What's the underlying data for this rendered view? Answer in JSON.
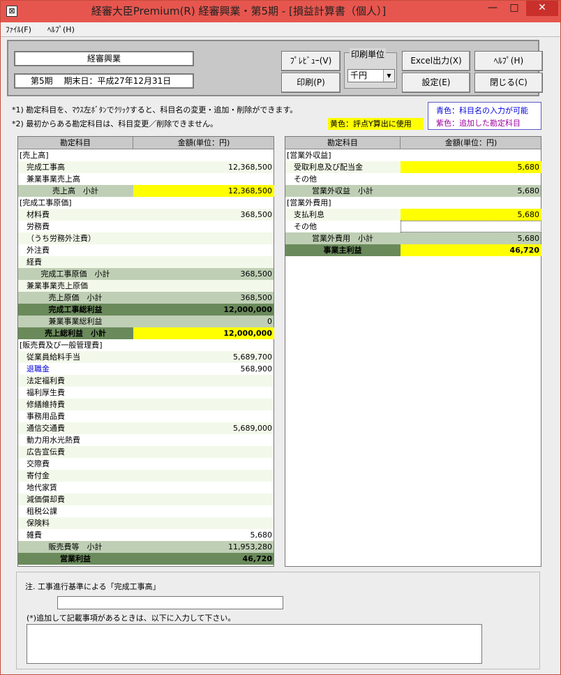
{
  "window": {
    "title": "経審大臣Premium(R)  経審興業・第5期 - [損益計算書（個人）]",
    "icon_glyph": "⊠",
    "minimize": "—",
    "maximize": "□",
    "close": "✕"
  },
  "menu": [
    "ﾌｧｲﾙ(F)",
    "ﾍﾙﾌﾟ(H)"
  ],
  "header": {
    "company": "経審興業",
    "period": "第5期　 期末日：平成27年12月31日",
    "unit_group_label": "印刷単位",
    "unit_value": "千円",
    "buttons": {
      "preview": "ﾌﾟﾚﾋﾞｭｰ(V)",
      "print": "印刷(P)",
      "excel": "Excel出力(X)",
      "settings": "設定(E)",
      "help": "ﾍﾙﾌﾟ(H)",
      "close": "閉じる(C)"
    }
  },
  "notes": {
    "note1": "*1) 勘定科目を、ﾏｳｽ左ﾎﾞﾀﾝでｸﾘｯｸすると、科目名の変更・追加・削除ができます。",
    "note2": "*2) 最初からある勘定科目は、科目変更／削除できません。",
    "yellow": "黄色：評点Y算出に使用",
    "blue": "青色：科目名の入力が可能",
    "purple": "紫色：追加した勘定科目"
  },
  "colors": {
    "title_bar": "#e6564e",
    "subtotal": "#bfcfb5",
    "total": "#6a8a5b",
    "highlight": "#ffff00",
    "blue_text": "#0000dd",
    "purple_text": "#a000a0"
  },
  "left_table": {
    "headers": [
      "勘定科目",
      "金額(単位：円)"
    ],
    "rows": [
      {
        "label": "[売上高]",
        "value": "",
        "type": "section"
      },
      {
        "label": "完成工事高",
        "value": "12,368,500",
        "type": "item"
      },
      {
        "label": "兼業事業売上高",
        "value": "",
        "type": "item"
      },
      {
        "label": "売上高　小計",
        "value": "12,368,500",
        "type": "subtotal",
        "hl": true
      },
      {
        "label": "[完成工事原価]",
        "value": "",
        "type": "section"
      },
      {
        "label": "材料費",
        "value": "368,500",
        "type": "item"
      },
      {
        "label": "労務費",
        "value": "",
        "type": "item"
      },
      {
        "label": "（うち労務外注費）",
        "value": "",
        "type": "item"
      },
      {
        "label": "外注費",
        "value": "",
        "type": "item"
      },
      {
        "label": "経費",
        "value": "",
        "type": "item"
      },
      {
        "label": "完成工事原価　小計",
        "value": "368,500",
        "type": "subtotal"
      },
      {
        "label": "兼業事業売上原価",
        "value": "",
        "type": "item"
      },
      {
        "label": "売上原価　小計",
        "value": "368,500",
        "type": "subtotal"
      },
      {
        "label": "完成工事総利益",
        "value": "12,000,000",
        "type": "total"
      },
      {
        "label": "兼業事業総利益",
        "value": "0",
        "type": "subtotal"
      },
      {
        "label": "売上総利益　小計",
        "value": "12,000,000",
        "type": "total",
        "hl": true
      },
      {
        "label": "[販売費及び一般管理費]",
        "value": "",
        "type": "section"
      },
      {
        "label": "従業員給料手当",
        "value": "5,689,700",
        "type": "item"
      },
      {
        "label": "退職金",
        "value": "568,900",
        "type": "item",
        "blue": true
      },
      {
        "label": "法定福利費",
        "value": "",
        "type": "item"
      },
      {
        "label": "福利厚生費",
        "value": "",
        "type": "item"
      },
      {
        "label": "修繕維持費",
        "value": "",
        "type": "item"
      },
      {
        "label": "事務用品費",
        "value": "",
        "type": "item"
      },
      {
        "label": "通信交通費",
        "value": "5,689,000",
        "type": "item"
      },
      {
        "label": "動力用水光熱費",
        "value": "",
        "type": "item"
      },
      {
        "label": "広告宣伝費",
        "value": "",
        "type": "item"
      },
      {
        "label": "交際費",
        "value": "",
        "type": "item"
      },
      {
        "label": "寄付金",
        "value": "",
        "type": "item"
      },
      {
        "label": "地代家賃",
        "value": "",
        "type": "item"
      },
      {
        "label": "減価償却費",
        "value": "",
        "type": "item"
      },
      {
        "label": "租税公課",
        "value": "",
        "type": "item"
      },
      {
        "label": "保険料",
        "value": "",
        "type": "item"
      },
      {
        "label": "雑費",
        "value": "5,680",
        "type": "item"
      },
      {
        "label": "販売費等　小計",
        "value": "11,953,280",
        "type": "subtotal"
      },
      {
        "label": "営業利益",
        "value": "46,720",
        "type": "total"
      }
    ]
  },
  "right_table": {
    "headers": [
      "勘定科目",
      "金額(単位：円)"
    ],
    "rows": [
      {
        "label": "[営業外収益]",
        "value": "",
        "type": "section"
      },
      {
        "label": "受取利息及び配当金",
        "value": "5,680",
        "type": "item",
        "hl": true
      },
      {
        "label": "その他",
        "value": "",
        "type": "item"
      },
      {
        "label": "営業外収益　小計",
        "value": "5,680",
        "type": "subtotal"
      },
      {
        "label": "[営業外費用]",
        "value": "",
        "type": "section"
      },
      {
        "label": "支払利息",
        "value": "5,680",
        "type": "item",
        "hl": true
      },
      {
        "label": "その他",
        "value": "",
        "type": "item",
        "focus": true
      },
      {
        "label": "営業外費用　小計",
        "value": "5,680",
        "type": "subtotal"
      },
      {
        "label": "事業主利益",
        "value": "46,720",
        "type": "total",
        "hl": true
      }
    ]
  },
  "bottom": {
    "note_label": "注. 工事進行基準による「完成工事高」",
    "input_value": "",
    "extra_label": "(*)追加して記載事項があるときは、以下に入力して下さい。",
    "extra_value": ""
  }
}
